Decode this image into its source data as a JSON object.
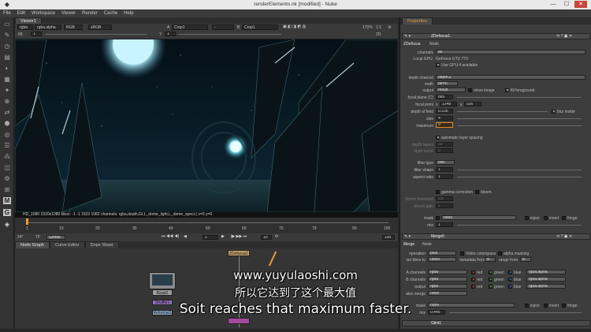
{
  "window": {
    "title": "renderElements.nk [modified] - Nuke",
    "minimize": "—",
    "maximize": "☐",
    "close": "✕"
  },
  "menu": [
    "File",
    "Edit",
    "Workspace",
    "Viewer",
    "Render",
    "Cache",
    "Help"
  ],
  "viewer": {
    "tab": "Viewer1",
    "layer": "rgba",
    "channel": "rgba.alpha",
    "display": "RGB",
    "colorspace": "sRGB",
    "input_a": "A",
    "input_a_node": "Crop1",
    "input_b": "B",
    "input_b_node": "Crop1",
    "zoom": "170%",
    "ratio": "1:1",
    "view_mode": "2D",
    "fstop": "f/8",
    "gain": "1",
    "y_label": "Y",
    "gamma": "1",
    "info": "HD_1080 1920x1080  bbox: -1 -1 1922 1082 channels: rgba,depth,GI,L_dome_light,L_dome_specL( x=0 y=0"
  },
  "timeline": {
    "ticks": [
      "1",
      "10",
      "20",
      "30",
      "40",
      "50",
      "60",
      "70",
      "79",
      "90",
      "100"
    ],
    "fps": "24*",
    "tf": "TF",
    "global": "Global",
    "current_frame": "1",
    "step": "10",
    "end_frame": "100"
  },
  "nodegraph": {
    "tabs": [
      "Node Graph",
      "Curve Editor",
      "Dope Sheet"
    ],
    "nodes": [
      "Read2",
      "Shuffle1",
      "Reformat1",
      "ZDefocus1"
    ]
  },
  "properties": {
    "tab": "Properties",
    "zdefocus": {
      "node_name": "ZDefocus1",
      "tabs": [
        "ZDefocus",
        "Node"
      ],
      "channels_label": "channels",
      "channels": "all",
      "gpu_label": "Local GPU:",
      "gpu": "GeForce GTX 770",
      "use_gpu": "Use GPU if available",
      "depth_channel_label": "depth channel",
      "depth_channel": "depth.Z",
      "math_label": "math",
      "math": "far=0",
      "output_label": "output",
      "output": "result",
      "show_image": "show image",
      "fill_foreground": "fill foreground",
      "focal_plane_label": "focal plane (C)",
      "focal_plane": "885",
      "focal_point_label": "focal point",
      "focal_x_label": "x",
      "focal_x": "1248",
      "focal_y_label": "y",
      "focal_y": "526",
      "dof_label": "depth of field",
      "dof": "0.235",
      "blur_inside": "blur inside",
      "size_label": "size",
      "size": "4",
      "maximum_label": "maximum",
      "maximum": "9",
      "auto_layer_spacing": "automatic layer spacing",
      "depth_layers_label": "depth layers",
      "depth_layers": "30",
      "layer_curve_label": "layer curve",
      "layer_curve": "0",
      "filter_type_label": "filter type",
      "filter_type": "disc",
      "filter_shape_label": "filter shape",
      "filter_shape": "1",
      "aspect_ratio_label": "aspect ratio",
      "aspect_ratio": "1",
      "gamma_correction": "gamma correction",
      "bloom": "bloom",
      "bloom_threshold_label": "bloom threshold",
      "bloom_threshold": "0.8",
      "bloom_gain_label": "bloom gain",
      "bloom_gain": "2",
      "mask_label": "mask",
      "mask": "none",
      "inject": "inject",
      "invert": "invert",
      "fringe": "fringe",
      "mix_label": "mix",
      "mix": "1"
    },
    "merge": {
      "node_name": "Merge5",
      "tabs": [
        "Merge",
        "Node"
      ],
      "operation_label": "operation",
      "operation": "plus",
      "video_colorspace": "Video colorspace",
      "alpha_masking": "alpha masking",
      "set_bbox_label": "set bbox to",
      "set_bbox": "union",
      "metadata_label": "metadata from",
      "metadata": "B",
      "range_label": "range from",
      "range": "B",
      "a_channels_label": "A channels",
      "a_channels": "rgba",
      "b_channels_label": "B channels",
      "b_channels": "rgba",
      "output_label": "output",
      "output": "rgba",
      "also_merge_label": "also merge",
      "also_merge": "none",
      "red": "red",
      "green": "green",
      "blue": "blue",
      "alpha_chan": "rgba.alpha",
      "mask_label": "mask",
      "mask": "none",
      "inject": "inject",
      "invert": "invert",
      "fringe": "fringe",
      "mix_label": "mix",
      "mix": "0.445"
    },
    "footer_node": "Glint1"
  },
  "subtitles": {
    "url": "www.yuyulaoshi.com",
    "chinese": "所以它达到了这个最大值",
    "english": "Soit reaches that maximum faster."
  },
  "colors": {
    "accent_orange": "#e79a3c",
    "selected_field": "#e38a2a",
    "sky": "#071b26",
    "moon": "#bfefff"
  }
}
